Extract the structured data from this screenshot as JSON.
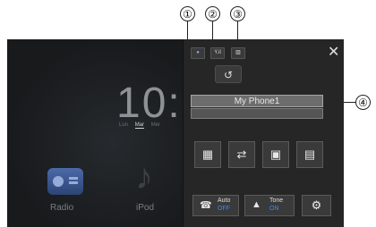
{
  "callouts": [
    "①",
    "②",
    "③",
    "④"
  ],
  "left": {
    "clock": "10:",
    "days": [
      "Lun",
      "Mar",
      "Mer"
    ],
    "apps": [
      "Radio",
      "iPod"
    ]
  },
  "panel": {
    "status_icons": [
      "bluetooth-icon",
      "signal-icon",
      "battery-icon"
    ],
    "signal_text": "Y.il",
    "battery_text": "▥",
    "close": "✕",
    "recent_calls_icon": "↺",
    "phone_name": "My Phone1",
    "buttons": [
      {
        "name": "keypad-button",
        "glyph": "▦"
      },
      {
        "name": "call-transfer-button",
        "glyph": "⇄"
      },
      {
        "name": "phonebook-button",
        "glyph": "▣"
      },
      {
        "name": "list-button",
        "glyph": "▤"
      }
    ],
    "auto_answer": {
      "label": "Auto",
      "value": "OFF",
      "icon": "☎"
    },
    "ring_tone": {
      "label": "Tone",
      "value": "ON",
      "icon": "▲"
    },
    "settings_icon": "⚙"
  },
  "colors": {
    "accent_blue": "#2f8fff",
    "panel_bg": "#262627"
  }
}
